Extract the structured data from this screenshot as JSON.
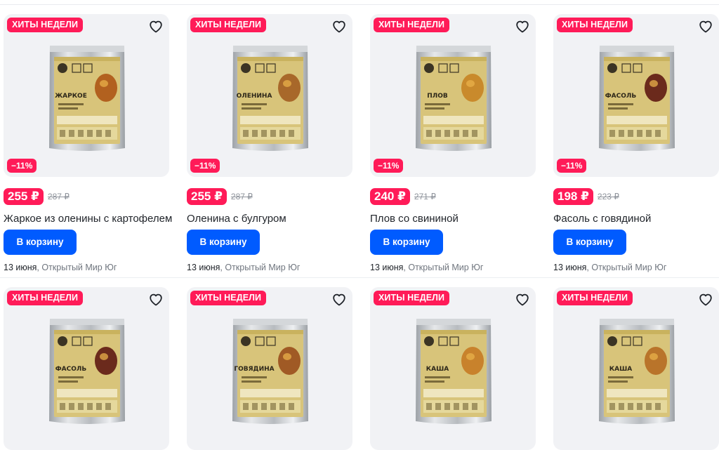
{
  "products_row1": [
    {
      "badge": "ХИТЫ НЕДЕЛИ",
      "discount": "−11%",
      "price": "255 ₽",
      "old_price": "287 ₽",
      "title": "Жаркое из оленины с картофелем",
      "button": "В корзину",
      "delivery_date": "13 июня",
      "delivery_sep": ", ",
      "seller": "Открытый Мир Юг",
      "pack_label": "ЖАРКОЕ"
    },
    {
      "badge": "ХИТЫ НЕДЕЛИ",
      "discount": "−11%",
      "price": "255 ₽",
      "old_price": "287 ₽",
      "title": "Оленина с булгуром",
      "button": "В корзину",
      "delivery_date": "13 июня",
      "delivery_sep": ", ",
      "seller": "Открытый Мир Юг",
      "pack_label": "ОЛЕНИНА"
    },
    {
      "badge": "ХИТЫ НЕДЕЛИ",
      "discount": "−11%",
      "price": "240 ₽",
      "old_price": "271 ₽",
      "title": "Плов со свининой",
      "button": "В корзину",
      "delivery_date": "13 июня",
      "delivery_sep": ", ",
      "seller": "Открытый Мир Юг",
      "pack_label": "ПЛОВ"
    },
    {
      "badge": "ХИТЫ НЕДЕЛИ",
      "discount": "−11%",
      "price": "198 ₽",
      "old_price": "223 ₽",
      "title": "Фасоль с говядиной",
      "button": "В корзину",
      "delivery_date": "13 июня",
      "delivery_sep": ", ",
      "seller": "Открытый Мир Юг",
      "pack_label": "ФАСОЛЬ"
    }
  ],
  "products_row2": [
    {
      "badge": "ХИТЫ НЕДЕЛИ",
      "pack_label": "ФАСОЛЬ"
    },
    {
      "badge": "ХИТЫ НЕДЕЛИ",
      "pack_label": "ГОВЯДИНА"
    },
    {
      "badge": "ХИТЫ НЕДЕЛИ",
      "pack_label": "КАША"
    },
    {
      "badge": "ХИТЫ НЕДЕЛИ",
      "pack_label": "КАША"
    }
  ],
  "icons": {
    "favorite": "heart-outline-icon"
  },
  "colors": {
    "accent": "#ff1b58",
    "button": "#005bff",
    "card_bg": "#f1f2f5"
  }
}
